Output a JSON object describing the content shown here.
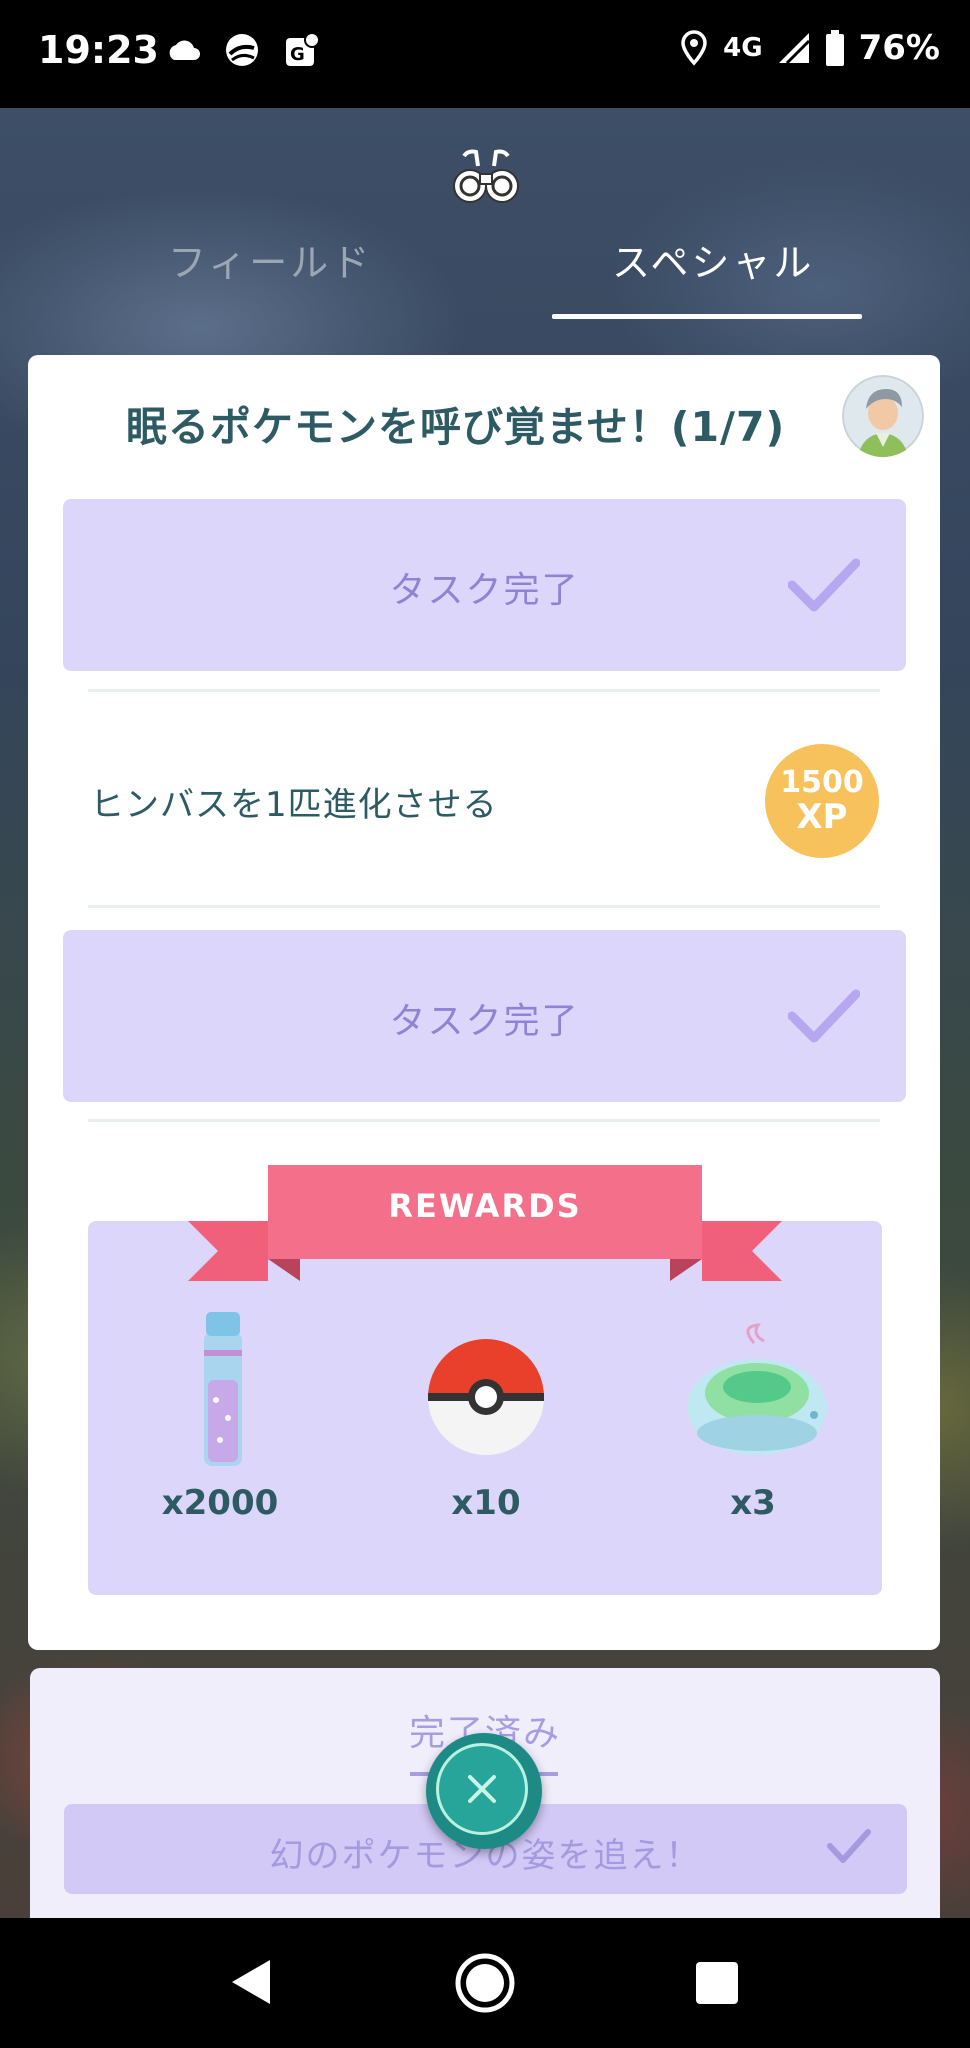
{
  "status_bar": {
    "time": "19:23",
    "network": "4G",
    "battery": "76%",
    "icons": [
      "cloud-icon",
      "sync-icon",
      "maps-icon",
      "location-icon",
      "signal-icon",
      "battery-icon"
    ]
  },
  "header": {
    "icon": "binoculars-icon",
    "tabs": [
      {
        "label": "フィールド",
        "active": false
      },
      {
        "label": "スペシャル",
        "active": true
      }
    ]
  },
  "research_card": {
    "title": "眠るポケモンを呼び覚ませ！(1/7)",
    "tasks": [
      {
        "state": "completed",
        "label": "タスク完了"
      },
      {
        "state": "open",
        "label": "ヒンバスを1匹進化させる",
        "reward_amount": "1500",
        "reward_unit": "XP"
      },
      {
        "state": "completed",
        "label": "タスク完了"
      }
    ],
    "rewards": {
      "title": "REWARDS",
      "items": [
        {
          "icon": "stardust-icon",
          "quantity": "x2000"
        },
        {
          "icon": "poke-ball-icon",
          "quantity": "x10"
        },
        {
          "icon": "incense-icon",
          "quantity": "x3"
        }
      ]
    }
  },
  "completed_section": {
    "tab_label": "完了済み",
    "task_label": "幻のポケモンの姿を追え！"
  },
  "colors": {
    "accent_purple": "#ddd6fb",
    "title_teal": "#2e5b63",
    "xp_gold": "#f7c25b",
    "ribbon_pink": "#f0607a",
    "close_button": "#27a59b"
  }
}
